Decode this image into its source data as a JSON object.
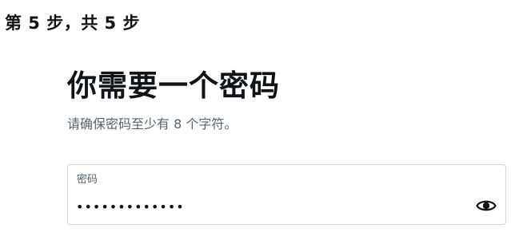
{
  "step_indicator": "第 5 步，共 5 步",
  "heading": "你需要一个密码",
  "subheading": "请确保密码至少有 8 个字符。",
  "password_field": {
    "label": "密码",
    "value": "•••••••••••••",
    "icon": "eye-icon"
  }
}
